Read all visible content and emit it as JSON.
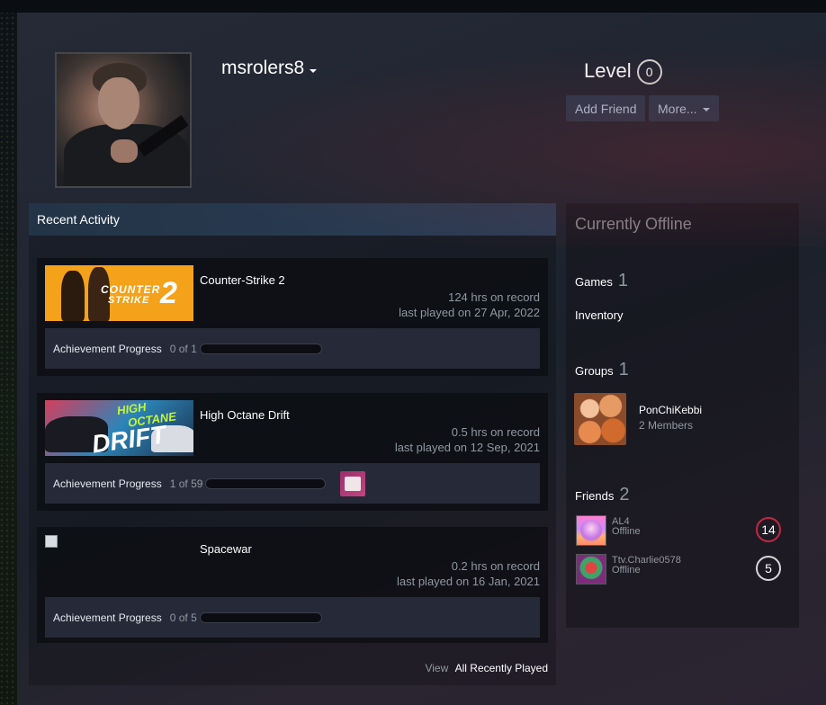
{
  "profile": {
    "username": "msrolers8",
    "level_label": "Level",
    "level": "0",
    "add_friend_label": "Add Friend",
    "more_label": "More..."
  },
  "recent_activity": {
    "title": "Recent Activity",
    "games": [
      {
        "name": "Counter-Strike 2",
        "hours": "124 hrs on record",
        "last_played": "last played on 27 Apr, 2022",
        "ach_label": "Achievement Progress",
        "ach_count": "0 of 1",
        "capsule_text": [
          "COUNTER",
          "STRIKE",
          "2"
        ]
      },
      {
        "name": "High Octane Drift",
        "hours": "0.5 hrs on record",
        "last_played": "last played on 12 Sep, 2021",
        "ach_label": "Achievement Progress",
        "ach_count": "1 of 59",
        "capsule_text": [
          "HIGH",
          "OCTANE",
          "DRIFT"
        ]
      },
      {
        "name": "Spacewar",
        "hours": "0.2 hrs on record",
        "last_played": "last played on 16 Jan, 2021",
        "ach_label": "Achievement Progress",
        "ach_count": "0 of 5"
      }
    ],
    "view_label": "View",
    "all_recent_label": "All Recently Played"
  },
  "sidebar": {
    "status": "Currently Offline",
    "games_label": "Games",
    "games_count": "1",
    "inventory_label": "Inventory",
    "groups_label": "Groups",
    "groups_count": "1",
    "group": {
      "name": "PonChiKebbi",
      "members": "2 Members"
    },
    "friends_label": "Friends",
    "friends_count": "2",
    "friends": [
      {
        "name": "AL4",
        "status": "Offline",
        "level": "14"
      },
      {
        "name": "Ttv.Charlie0578",
        "status": "Offline",
        "level": "5"
      }
    ]
  },
  "colors": {
    "accent": "#2a3a4e",
    "friend_level_red": "#c02942"
  }
}
